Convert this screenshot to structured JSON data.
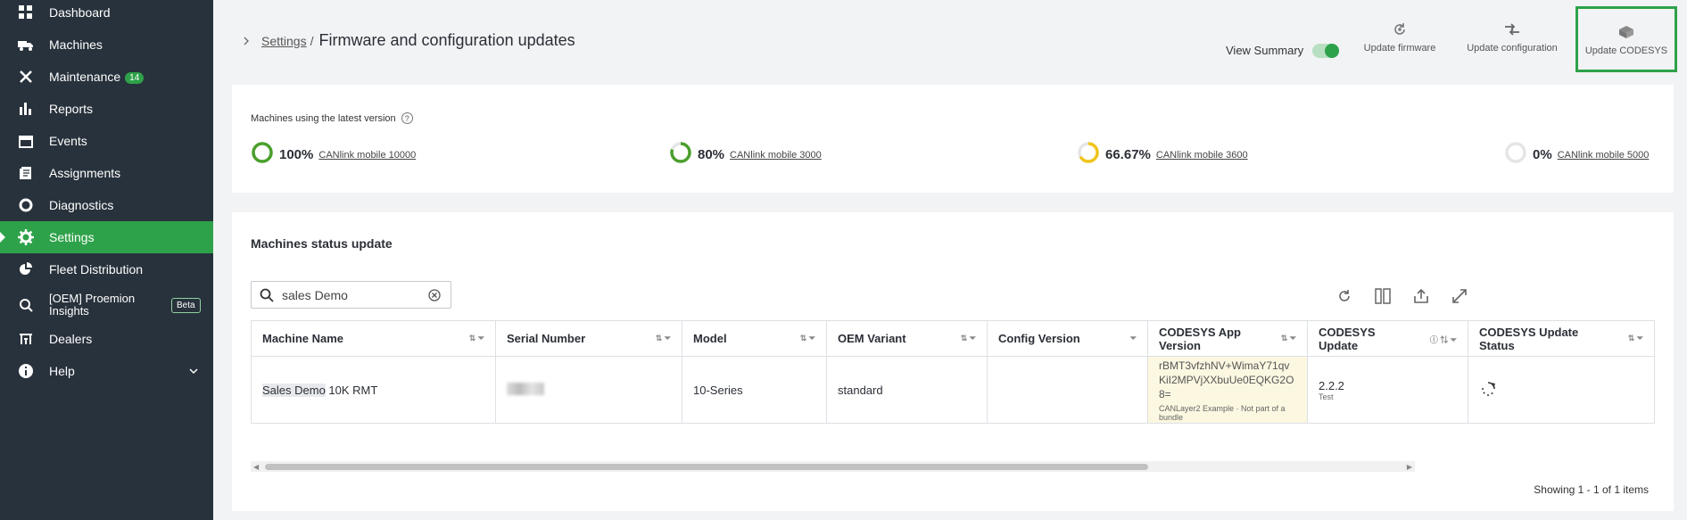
{
  "sidebar": {
    "items": [
      {
        "label": "Dashboard",
        "icon": "dashboard-icon"
      },
      {
        "label": "Machines",
        "icon": "truck-icon"
      },
      {
        "label": "Maintenance",
        "icon": "tools-icon",
        "badge": "14"
      },
      {
        "label": "Reports",
        "icon": "bar-chart-icon"
      },
      {
        "label": "Events",
        "icon": "calendar-icon"
      },
      {
        "label": "Assignments",
        "icon": "document-icon"
      },
      {
        "label": "Diagnostics",
        "icon": "diagnostics-icon"
      },
      {
        "label": "Settings",
        "icon": "gear-icon",
        "active": true
      },
      {
        "label": "Fleet Distribution",
        "icon": "pie-chart-icon"
      },
      {
        "label": "[OEM] Proemion Insights",
        "icon": "insights-icon",
        "beta": "Beta"
      },
      {
        "label": "Dealers",
        "icon": "dealers-icon"
      },
      {
        "label": "Help",
        "icon": "info-icon"
      }
    ]
  },
  "header": {
    "breadcrumb_link": "Settings",
    "breadcrumb_sep": "/",
    "title": "Firmware and configuration updates",
    "view_summary": "View Summary",
    "view_summary_on": true,
    "buttons": {
      "update_firmware": "Update firmware",
      "update_configuration": "Update configuration",
      "update_codesys": "Update CODESYS"
    }
  },
  "latest": {
    "title": "Machines using the latest version",
    "items": [
      {
        "pct": "100%",
        "value": 1.0,
        "name": "CANlink mobile 10000",
        "color": "#4aa02c"
      },
      {
        "pct": "80%",
        "value": 0.8,
        "name": "CANlink mobile 3000",
        "color": "#4aa02c"
      },
      {
        "pct": "66.67%",
        "value": 0.6667,
        "name": "CANlink mobile 3600",
        "color": "#f0c419"
      },
      {
        "pct": "0%",
        "value": 0.0,
        "name": "CANlink mobile 5000",
        "color": "#e5e5e5"
      }
    ]
  },
  "status": {
    "title": "Machines status update",
    "search_value": "sales Demo",
    "columns": [
      "Machine Name",
      "Serial Number",
      "Model",
      "OEM Variant",
      "Config Version",
      "CODESYS App Version",
      "CODESYS Update",
      "CODESYS Update Status"
    ],
    "row": {
      "machine_highlight": "Sales Demo",
      "machine_rest": " 10K RMT",
      "model": "10-Series",
      "oem_variant": "standard",
      "config_version": "",
      "codesys_app_version": "rBMT3vfzhNV+WimaY71qvKiI2MPVjXXbuUe0EQKG2O8=",
      "codesys_app_sub": "CANLayer2 Example · Not part of a bundle",
      "codesys_update": "2.2.2",
      "codesys_update_sub": "Test"
    },
    "showing": "Showing 1 - 1 of 1 items"
  }
}
